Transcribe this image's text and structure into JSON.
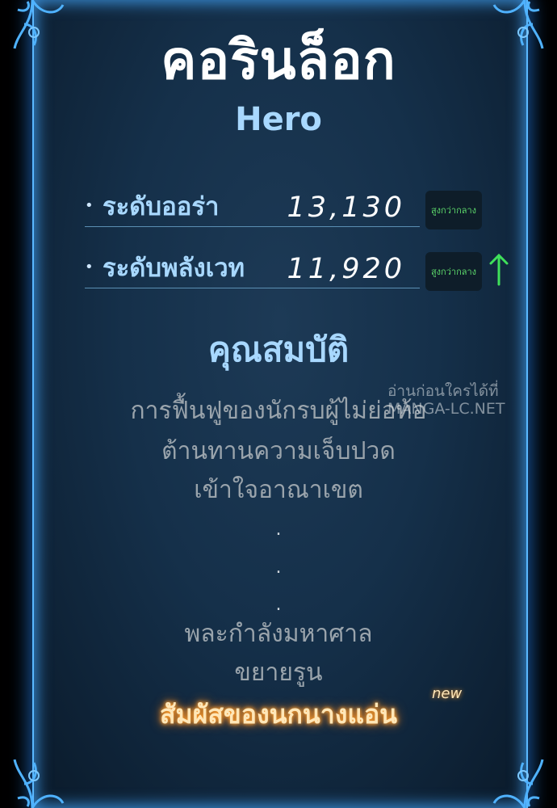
{
  "title": "คอรินล็อก",
  "subtitle": "Hero",
  "stats": [
    {
      "label": "ระดับออร่า",
      "value": "13,130",
      "badge": "สูงกว่ากลาง",
      "trend": ""
    },
    {
      "label": "ระดับพลังเวท",
      "value": "11,920",
      "badge": "สูงกว่ากลาง",
      "trend": "up"
    }
  ],
  "traits_heading": "คุณสมบัติ",
  "traits": [
    "การฟื้นฟูของนักรบผู้ไม่ย่อท้อ",
    "ต้านทานความเจ็บปวด",
    "เข้าใจอาณาเขต"
  ],
  "ellipsis": [
    ".",
    ".",
    "."
  ],
  "traits_more": [
    "พละกำลังมหาศาล",
    "ขยายรูน"
  ],
  "new_trait": "สัมผัสของนกนางแอ่น",
  "new_tag": "new",
  "watermark": {
    "line1": "อ่านก่อนใครได้ที่",
    "line2": "MANGA-LC.NET"
  },
  "colors": {
    "panel": "#15304a",
    "glow": "#5ab8ff",
    "heading": "#a8d8ff",
    "badge_text": "#5dd96b",
    "new_glow": "#ff9d2a"
  }
}
